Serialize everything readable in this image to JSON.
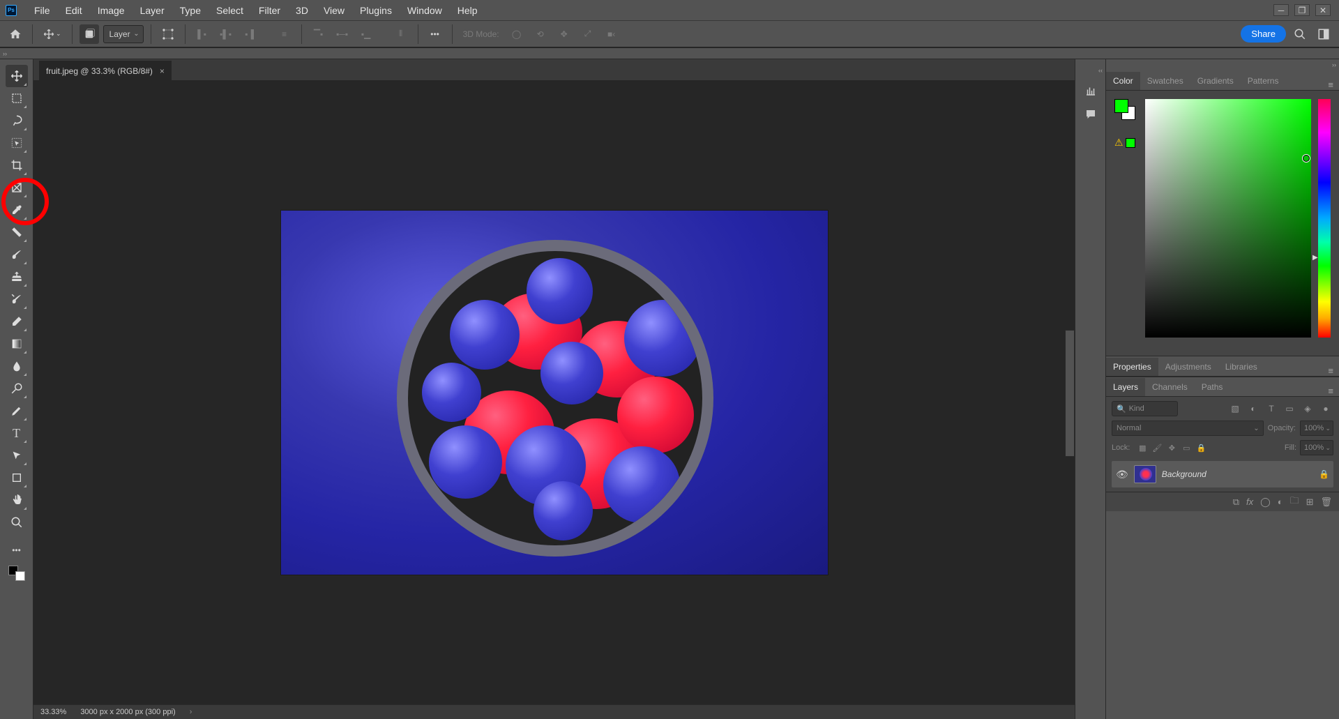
{
  "menu": {
    "items": [
      "File",
      "Edit",
      "Image",
      "Layer",
      "Type",
      "Select",
      "Filter",
      "3D",
      "View",
      "Plugins",
      "Window",
      "Help"
    ]
  },
  "options": {
    "transform_label": "Layer",
    "mode3d_label": "3D Mode:",
    "share_label": "Share"
  },
  "document": {
    "tab_label": "fruit.jpeg @ 33.3% (RGB/8#)",
    "zoom": "33.33%",
    "dimensions": "3000 px x 2000 px (300 ppi)"
  },
  "panels": {
    "color_tabs": [
      "Color",
      "Swatches",
      "Gradients",
      "Patterns"
    ],
    "props_tabs": [
      "Properties",
      "Adjustments",
      "Libraries"
    ],
    "layer_tabs": [
      "Layers",
      "Channels",
      "Paths"
    ],
    "layers": {
      "search_placeholder": "Kind",
      "blend_mode": "Normal",
      "opacity_label": "Opacity:",
      "opacity_value": "100%",
      "lock_label": "Lock:",
      "fill_label": "Fill:",
      "fill_value": "100%",
      "layer0": "Background"
    }
  },
  "colors": {
    "foreground": "#00ff00",
    "background": "#ffffff"
  }
}
